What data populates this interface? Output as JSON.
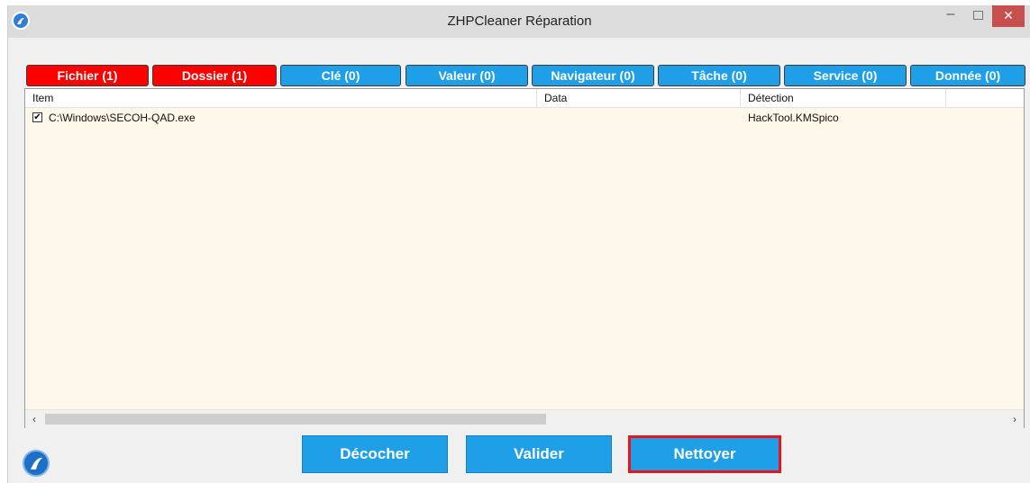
{
  "window": {
    "title": "ZHPCleaner Réparation"
  },
  "tabs": [
    {
      "label": "Fichier  (1)",
      "state": "red"
    },
    {
      "label": "Dossier  (1)",
      "state": "red"
    },
    {
      "label": "Clé  (0)",
      "state": "blue"
    },
    {
      "label": "Valeur  (0)",
      "state": "blue"
    },
    {
      "label": "Navigateur  (0)",
      "state": "blue"
    },
    {
      "label": "Tâche  (0)",
      "state": "blue"
    },
    {
      "label": "Service  (0)",
      "state": "blue"
    },
    {
      "label": "Donnée  (0)",
      "state": "blue"
    }
  ],
  "table": {
    "columns": [
      "Item",
      "Data",
      "Détection"
    ],
    "rows": [
      {
        "checked": true,
        "item": "C:\\Windows\\SECOH-QAD.exe",
        "data": "",
        "detection": "HackTool.KMSpico"
      }
    ]
  },
  "buttons": {
    "uncheck": "Décocher",
    "validate": "Valider",
    "clean": "Nettoyer"
  },
  "icons": {
    "app": "zhpcleaner-logo-icon",
    "minimize": "minimize-icon",
    "maximize": "maximize-icon",
    "close": "close-icon",
    "check": "checkmark-icon",
    "scroll_left": "chevron-left-icon",
    "scroll_right": "chevron-right-icon"
  },
  "colors": {
    "tab_red": "#ff0000",
    "tab_blue": "#1e9fe8",
    "button_blue": "#1e9fe8",
    "highlight_border": "#e8141b",
    "grid_background": "#fdf8e9"
  }
}
